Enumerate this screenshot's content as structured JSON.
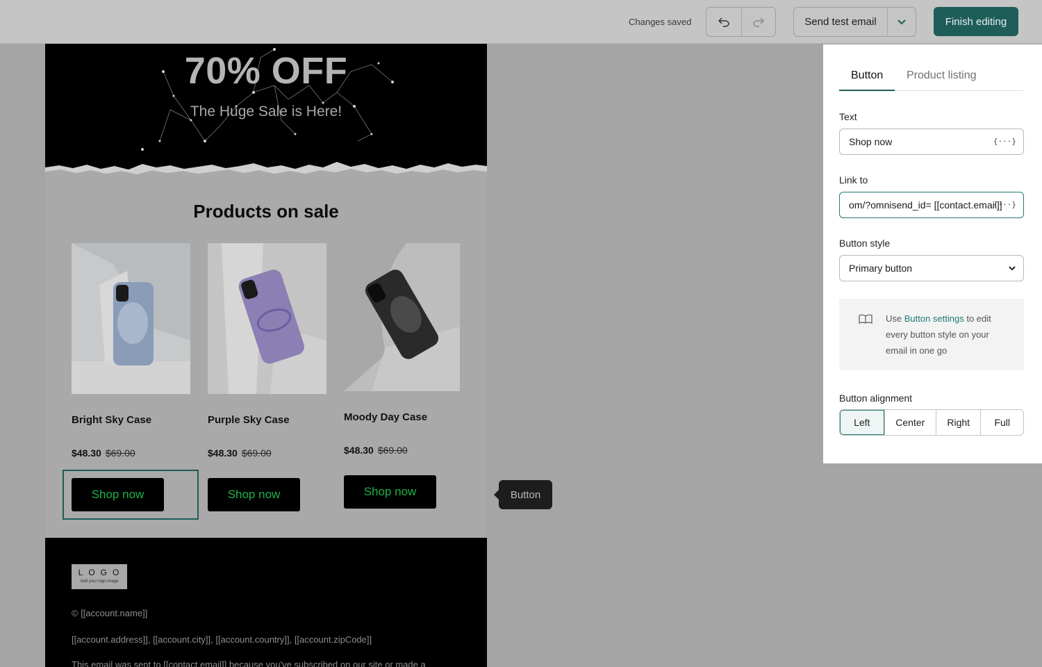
{
  "topbar": {
    "status": "Changes saved",
    "send_test_label": "Send test email",
    "finish_label": "Finish editing"
  },
  "email": {
    "hero_title": "70% OFF",
    "hero_subtitle": "The Huge Sale is Here!",
    "section_title": "Products on sale",
    "products": [
      {
        "name": "Bright Sky Case",
        "price": "$48.30",
        "old_price": "$69.00",
        "button": "Shop now"
      },
      {
        "name": "Purple Sky Case",
        "price": "$48.30",
        "old_price": "$69.00",
        "button": "Shop now"
      },
      {
        "name": "Moody Day Case",
        "price": "$48.30",
        "old_price": "$69.00",
        "button": "Shop now"
      }
    ],
    "footer": {
      "logo_text": "LOGO",
      "logo_sub": "Add your logo image",
      "account_name": "© [[account.name]]",
      "address": "[[account.address]], [[account.city]], [[account.country]], [[account.zipCode]]",
      "notice": "This email was sent to [[contact.email]] because you've subscribed on our site or made a"
    }
  },
  "tooltip": "Button",
  "panel": {
    "tabs": [
      {
        "label": "Button"
      },
      {
        "label": "Product listing"
      }
    ],
    "text_label": "Text",
    "text_value": "Shop now",
    "link_label": "Link to",
    "link_value": "om/?omnisend_id= [[contact.email]]",
    "style_label": "Button style",
    "style_value": "Primary button",
    "info_prefix": "Use ",
    "info_link": "Button settings",
    "info_suffix": " to edit every button style on your email in one go",
    "alignment_label": "Button alignment",
    "alignment_options": [
      "Left",
      "Center",
      "Right",
      "Full"
    ],
    "alignment_selected": "Left",
    "var_icon": "{···}"
  },
  "colors": {
    "accent": "#1e5b57",
    "shop_text": "#1fb24a"
  }
}
